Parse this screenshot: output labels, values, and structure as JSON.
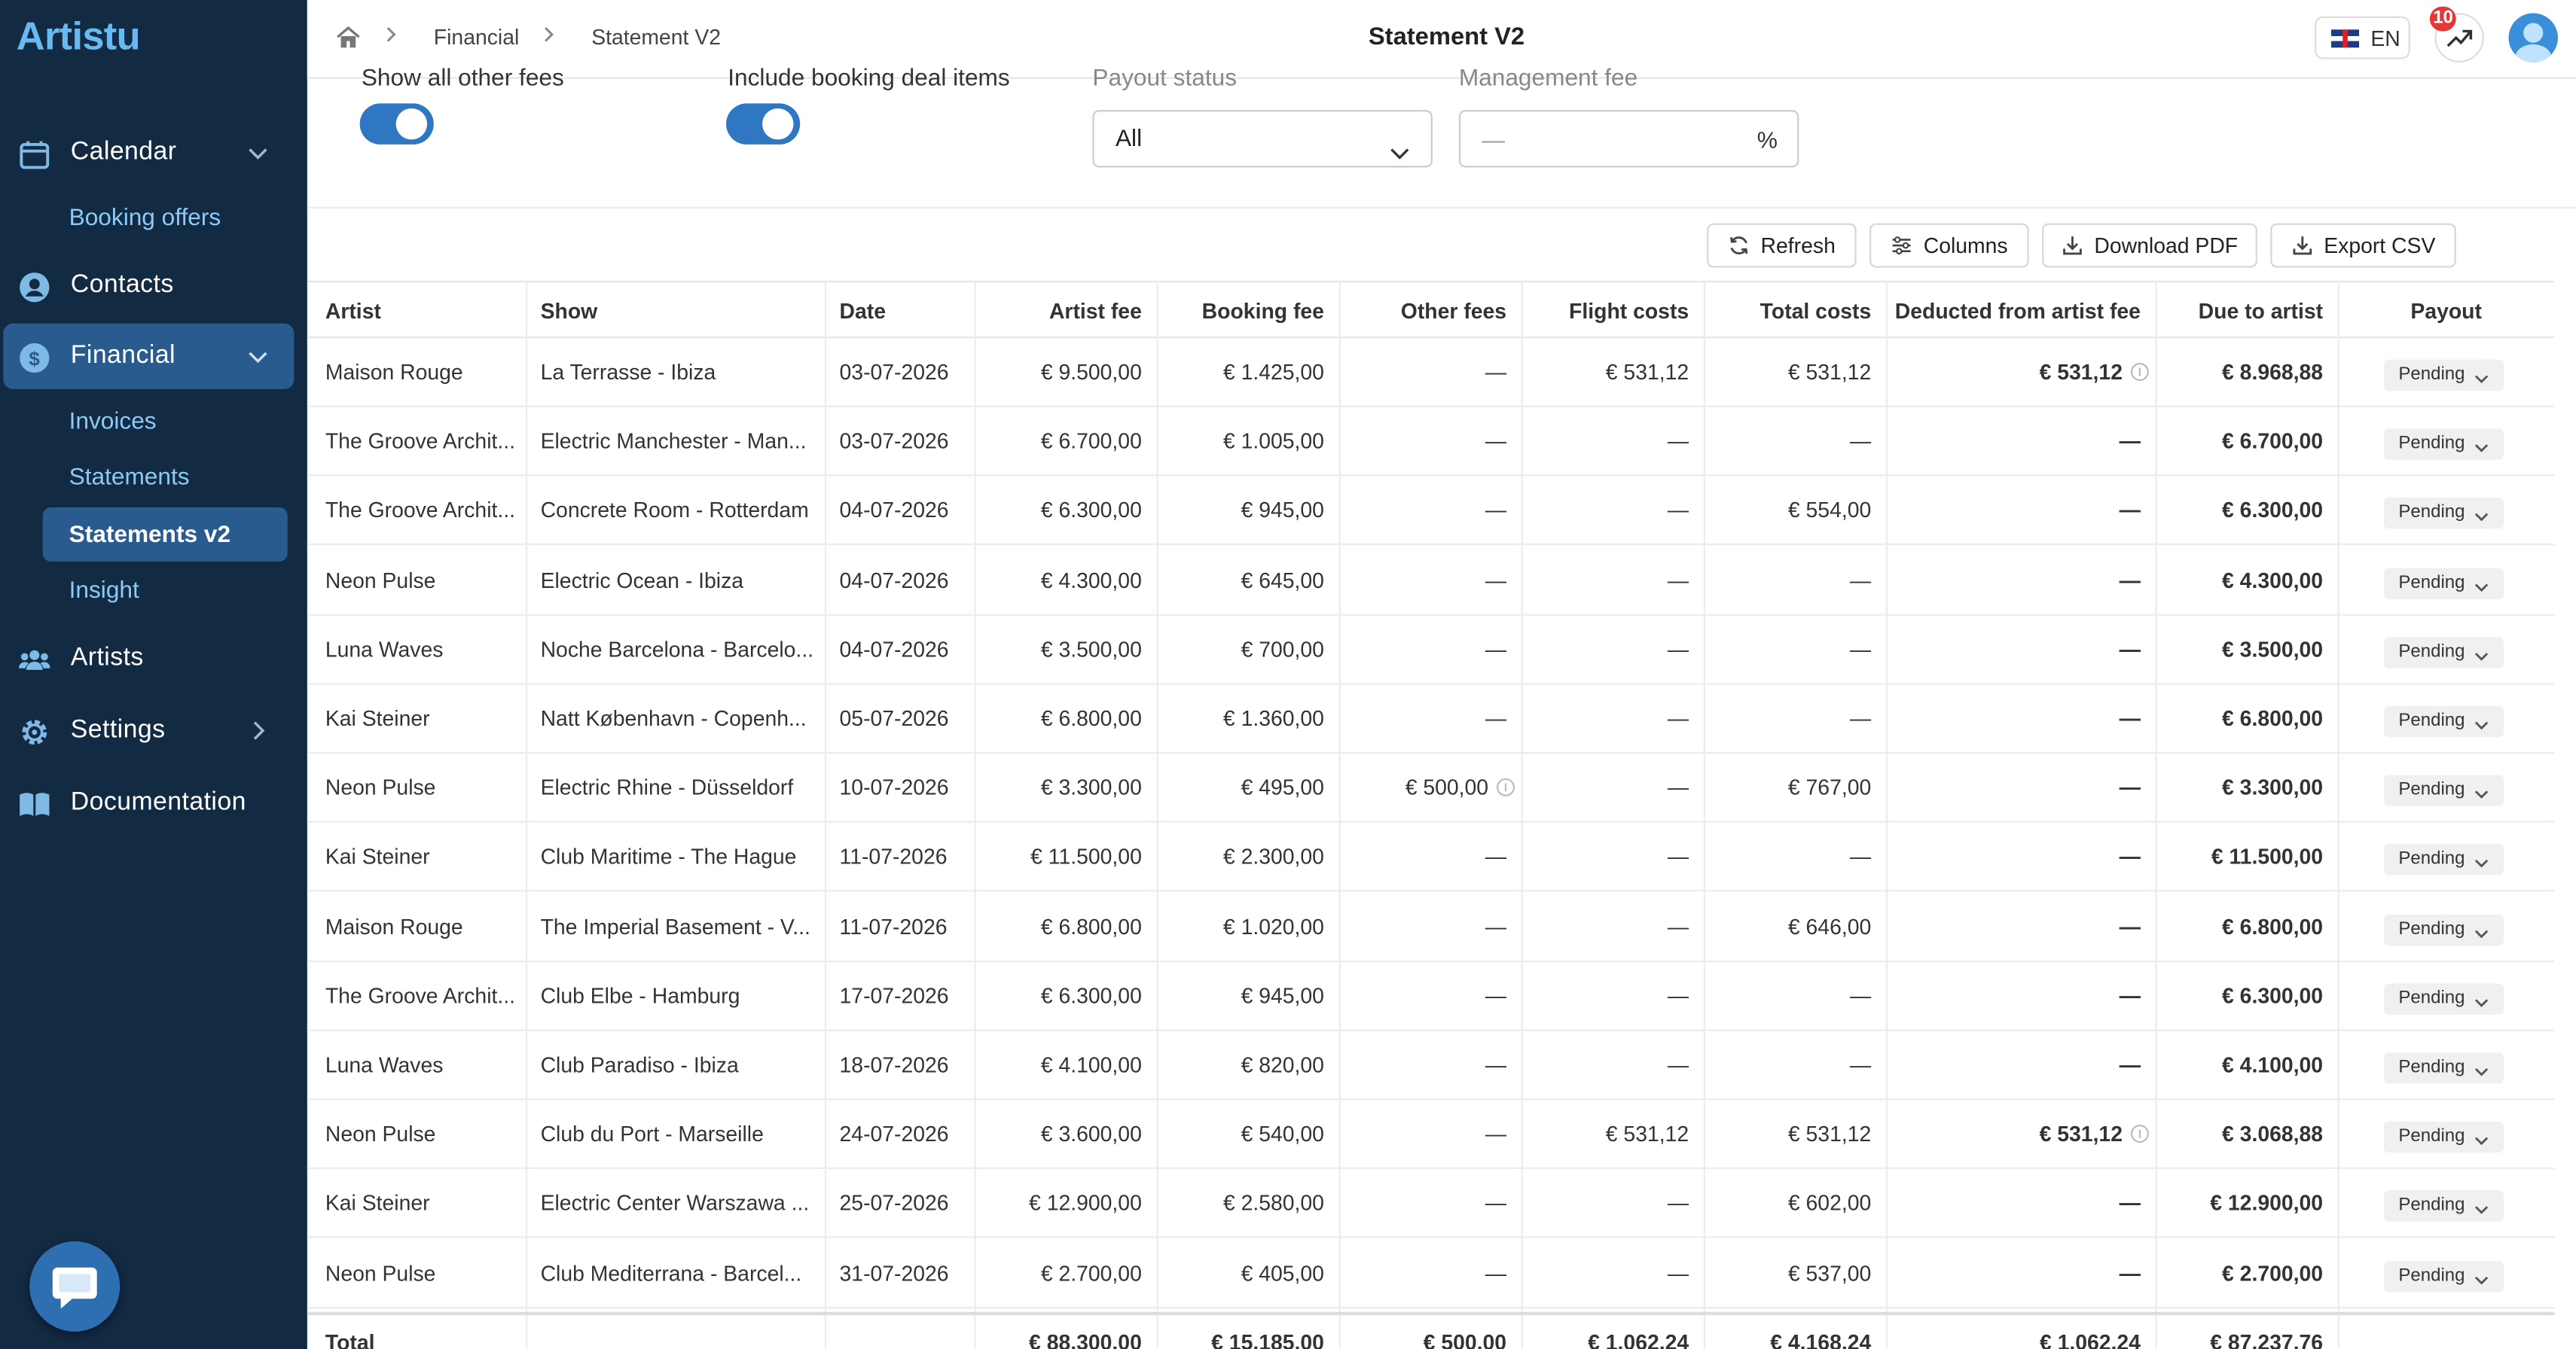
{
  "app": {
    "logo": "Artistu"
  },
  "sidebar": {
    "calendar": "Calendar",
    "booking_offers": "Booking offers",
    "contacts": "Contacts",
    "financial": "Financial",
    "invoices": "Invoices",
    "statements": "Statements",
    "statements_v2": "Statements v2",
    "insight": "Insight",
    "artists": "Artists",
    "settings": "Settings",
    "documentation": "Documentation"
  },
  "header": {
    "breadcrumb": [
      "Financial",
      "Statement V2"
    ],
    "title": "Statement V2",
    "language": "EN",
    "notification_count": "10"
  },
  "filters": {
    "show_other_fees_label": "Show all other fees",
    "show_other_fees_on": true,
    "include_booking_label": "Include booking deal items",
    "include_booking_on": true,
    "payout_status_label": "Payout status",
    "payout_status_value": "All",
    "management_fee_label": "Management fee",
    "management_fee_placeholder": "—",
    "management_fee_unit": "%"
  },
  "toolbar": {
    "refresh": "Refresh",
    "columns": "Columns",
    "download_pdf": "Download PDF",
    "export_csv": "Export CSV"
  },
  "table": {
    "columns": [
      "Artist",
      "Show",
      "Date",
      "Artist fee",
      "Booking fee",
      "Other fees",
      "Flight costs",
      "Total costs",
      "Deducted from artist fee",
      "Due to artist",
      "Payout"
    ],
    "rows": [
      [
        "Maison Rouge",
        "La Terrasse - Ibiza",
        "03-07-2026",
        "€ 9.500,00",
        "€ 1.425,00",
        "—",
        "€ 531,12",
        "€ 531,12",
        "€ 531,12",
        "€ 8.968,88",
        "Pending"
      ],
      [
        "The Groove Archit...",
        "Electric Manchester - Man...",
        "03-07-2026",
        "€ 6.700,00",
        "€ 1.005,00",
        "—",
        "—",
        "—",
        "—",
        "€ 6.700,00",
        "Pending"
      ],
      [
        "The Groove Archit...",
        "Concrete Room - Rotterdam",
        "04-07-2026",
        "€ 6.300,00",
        "€ 945,00",
        "—",
        "—",
        "€ 554,00",
        "—",
        "€ 6.300,00",
        "Pending"
      ],
      [
        "Neon Pulse",
        "Electric Ocean - Ibiza",
        "04-07-2026",
        "€ 4.300,00",
        "€ 645,00",
        "—",
        "—",
        "—",
        "—",
        "€ 4.300,00",
        "Pending"
      ],
      [
        "Luna Waves",
        "Noche Barcelona - Barcelo...",
        "04-07-2026",
        "€ 3.500,00",
        "€ 700,00",
        "—",
        "—",
        "—",
        "—",
        "€ 3.500,00",
        "Pending"
      ],
      [
        "Kai Steiner",
        "Natt København - Copenh...",
        "05-07-2026",
        "€ 6.800,00",
        "€ 1.360,00",
        "—",
        "—",
        "—",
        "—",
        "€ 6.800,00",
        "Pending"
      ],
      [
        "Neon Pulse",
        "Electric Rhine - Düsseldorf",
        "10-07-2026",
        "€ 3.300,00",
        "€ 495,00",
        "€ 500,00",
        "—",
        "€ 767,00",
        "—",
        "€ 3.300,00",
        "Pending"
      ],
      [
        "Kai Steiner",
        "Club Maritime - The Hague",
        "11-07-2026",
        "€ 11.500,00",
        "€ 2.300,00",
        "—",
        "—",
        "—",
        "—",
        "€ 11.500,00",
        "Pending"
      ],
      [
        "Maison Rouge",
        "The Imperial Basement - V...",
        "11-07-2026",
        "€ 6.800,00",
        "€ 1.020,00",
        "—",
        "—",
        "€ 646,00",
        "—",
        "€ 6.800,00",
        "Pending"
      ],
      [
        "The Groove Archit...",
        "Club Elbe - Hamburg",
        "17-07-2026",
        "€ 6.300,00",
        "€ 945,00",
        "—",
        "—",
        "—",
        "—",
        "€ 6.300,00",
        "Pending"
      ],
      [
        "Luna Waves",
        "Club Paradiso - Ibiza",
        "18-07-2026",
        "€ 4.100,00",
        "€ 820,00",
        "—",
        "—",
        "—",
        "—",
        "€ 4.100,00",
        "Pending"
      ],
      [
        "Neon Pulse",
        "Club du Port - Marseille",
        "24-07-2026",
        "€ 3.600,00",
        "€ 540,00",
        "—",
        "€ 531,12",
        "€ 531,12",
        "€ 531,12",
        "€ 3.068,88",
        "Pending"
      ],
      [
        "Kai Steiner",
        "Electric Center Warszawa ...",
        "25-07-2026",
        "€ 12.900,00",
        "€ 2.580,00",
        "—",
        "—",
        "€ 602,00",
        "—",
        "€ 12.900,00",
        "Pending"
      ],
      [
        "Neon Pulse",
        "Club Mediterrana - Barcel...",
        "31-07-2026",
        "€ 2.700,00",
        "€ 405,00",
        "—",
        "—",
        "€ 537,00",
        "—",
        "€ 2.700,00",
        "Pending"
      ]
    ],
    "info_marks": [
      [
        0,
        8
      ],
      [
        6,
        5
      ],
      [
        11,
        8
      ]
    ],
    "total": [
      "Total",
      "",
      "",
      "€ 88.300,00",
      "€ 15.185,00",
      "€ 500,00",
      "€ 1.062,24",
      "€ 4.168,24",
      "€ 1.062,24",
      "€ 87.237,76",
      ""
    ]
  },
  "colors": {
    "sidebar_bg": "#132a43",
    "active_bg": "#2a5b8e",
    "accent": "#2f77c2",
    "link": "#8ccbf7"
  }
}
